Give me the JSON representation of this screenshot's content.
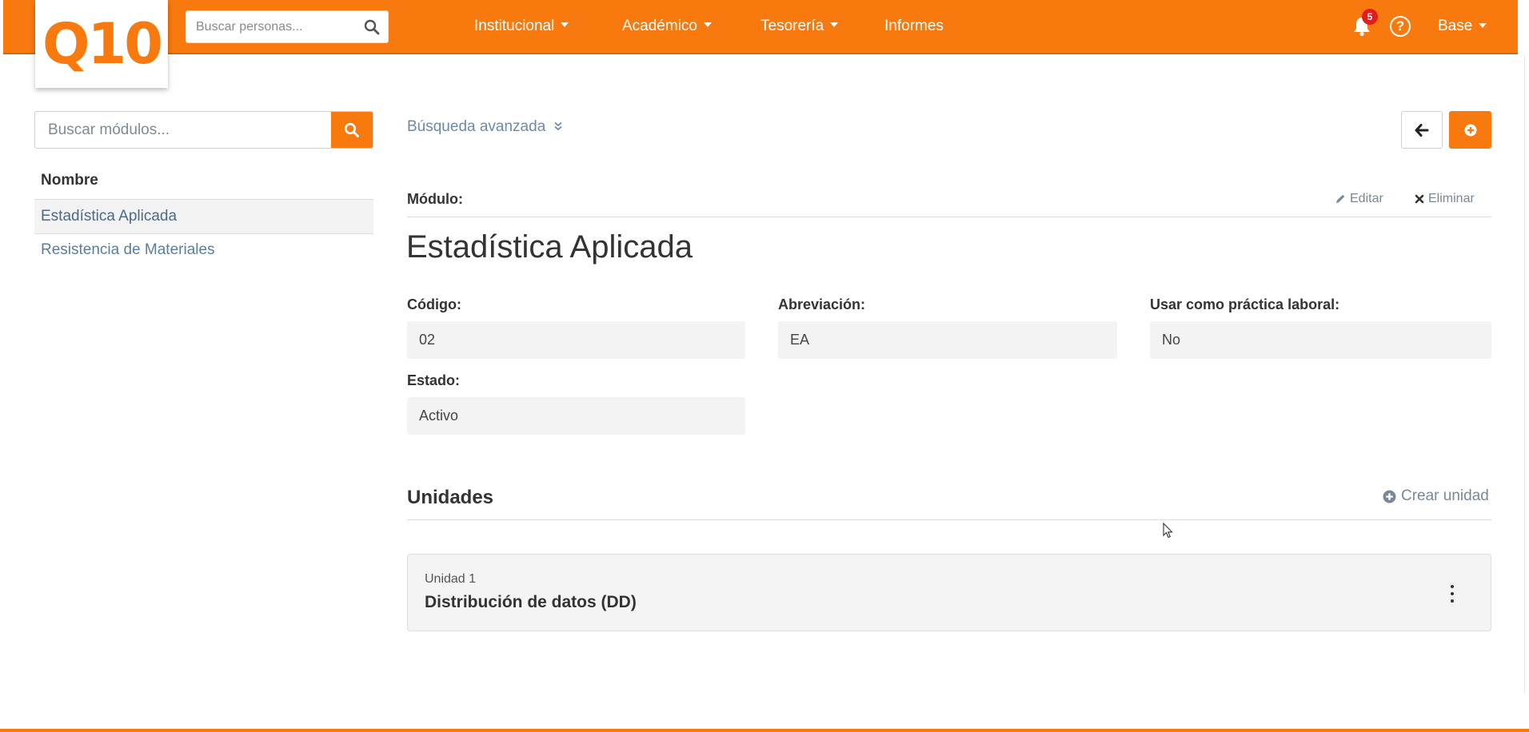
{
  "header": {
    "logo_text": "Q10",
    "person_search_placeholder": "Buscar personas...",
    "nav": [
      {
        "label": "Institucional",
        "dropdown": true
      },
      {
        "label": "Académico",
        "dropdown": true
      },
      {
        "label": "Tesorería",
        "dropdown": true
      },
      {
        "label": "Informes",
        "dropdown": false
      }
    ],
    "notifications_count": "5",
    "help_glyph": "?",
    "user_menu_label": "Base"
  },
  "sidebar": {
    "search_placeholder": "Buscar módulos...",
    "column_header": "Nombre",
    "items": [
      {
        "label": "Estadística Aplicada",
        "active": true
      },
      {
        "label": "Resistencia de Materiales",
        "active": false
      }
    ]
  },
  "main": {
    "advanced_search_label": "Búsqueda avanzada",
    "module_label": "Módulo:",
    "edit_label": "Editar",
    "delete_label": "Eliminar",
    "module_title": "Estadística Aplicada",
    "fields": {
      "codigo": {
        "label": "Código:",
        "value": "02"
      },
      "abreviacion": {
        "label": "Abreviación:",
        "value": "EA"
      },
      "practica": {
        "label": "Usar como práctica laboral:",
        "value": "No"
      },
      "estado": {
        "label": "Estado:",
        "value": "Activo"
      }
    },
    "units_title": "Unidades",
    "create_unit_label": "Crear unidad",
    "units": [
      {
        "number": "Unidad 1",
        "name": "Distribución de datos (DD)"
      }
    ]
  },
  "colors": {
    "brand": "#f8790d",
    "badge": "#e21b1b",
    "link": "#5c7d99"
  },
  "icons": [
    "search-icon",
    "caret-down-icon",
    "bell-icon",
    "help-icon",
    "arrow-left-icon",
    "plus-circle-icon",
    "pencil-icon",
    "times-icon",
    "double-chevron-down-icon",
    "kebab-menu-icon",
    "mouse-cursor-icon"
  ]
}
